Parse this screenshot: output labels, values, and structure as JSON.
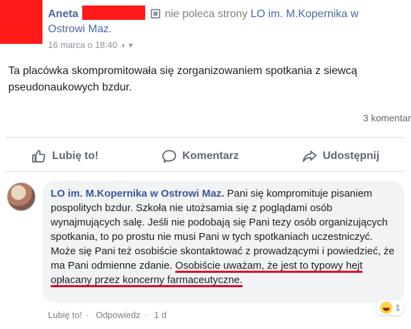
{
  "post": {
    "author_name": "Aneta",
    "review_text": "nie poleca strony",
    "page_name_part1": "LO im. M.Kopernika w",
    "page_name_part2": "Ostrowi Maz.",
    "date": "16 marca o 18:40",
    "privacy_symbol": "◐ ▾",
    "text": "Ta placówka skompromitowała się zorganizowaniem spotkania z siewcą pseudonaukowych bzdur.",
    "comments_count": "3 komentar"
  },
  "actions": {
    "like": "Lubię to!",
    "comment": "Komentarz",
    "share": "Udostępnij"
  },
  "comment": {
    "author": "LO im. M.Kopernika w Ostrowi Maz.",
    "text_normal": "Pani się kompromituje pisaniem pospolitych bzdur. Szkoła nie utożsamia się z poglądami osób wynajmujących salę. Jeśli nie podobają się Pani tezy osób organizujących spotkania, to po prostu nie musi Pani w tych spotkaniach uczestniczyć. Może się Pani też osobiście skontaktować z prowadzącymi i powiedzieć, że ma Pani odmienne zdanie.",
    "text_underlined": "Osobiście uważam, że jest to typowy hejt opłacany przez koncerny farmaceutyczne.",
    "like_label": "Lubię to!",
    "reply_label": "Odpowiedz",
    "time": "1 d",
    "reaction_count": "1"
  },
  "colors": {
    "redaction": "#ff1a1a",
    "link_blue": "#385898",
    "underline_red": "#e3002a"
  }
}
